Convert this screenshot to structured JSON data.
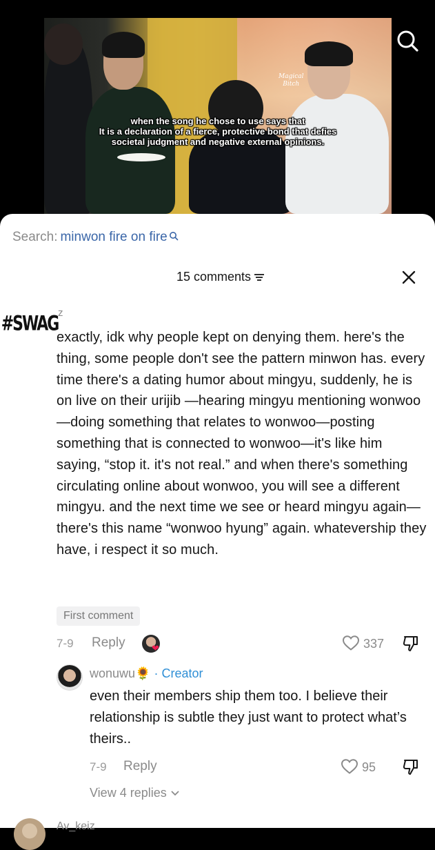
{
  "video": {
    "subtitle_line1": "when the song he chose to use says that",
    "subtitle_line2": "It is a declaration of a fierce, protective bond that defies",
    "subtitle_line3": "societal judgment and negative external opinions.",
    "sign_line1": "Magical",
    "sign_line2": "Bitch"
  },
  "search": {
    "prefix": "Search:",
    "query": "minwon fire on fire"
  },
  "comments_header": {
    "count_label": "15 comments"
  },
  "comment": {
    "avatar_text": "#SWAG",
    "username": "z",
    "text": "exactly, idk why people kept on denying them. here's the thing, some people don't see the pattern minwon has. every time there's a dating humor about mingyu, suddenly, he is on live on their urijib —hearing mingyu mentioning wonwoo—doing something that relates to wonwoo—posting something that is connected to wonwoo—it's like him saying, “stop it. it's not real.” and when there's something circulating online about wonwoo, you will see a different mingyu. and the next time we see or heard mingyu again—there's this name “wonwoo hyung” again. whatevership they have, i respect it so much.",
    "badge": "First comment",
    "date": "7-9",
    "reply_label": "Reply",
    "likes": "337"
  },
  "reply": {
    "username": "wonuwu",
    "emoji": "🌻",
    "separator": "·",
    "creator_label": "Creator",
    "text": "even their members ship them too. I believe their relationship is subtle they just want to protect what’s theirs..",
    "date": "7-9",
    "reply_label": "Reply",
    "likes": "95"
  },
  "view_replies": "View 4 replies",
  "next_comment_user": "Av_keiz",
  "colors": {
    "creator": "#2f8fd6",
    "search_query": "#3a66a8",
    "liked_heart": "#ee1d52"
  }
}
